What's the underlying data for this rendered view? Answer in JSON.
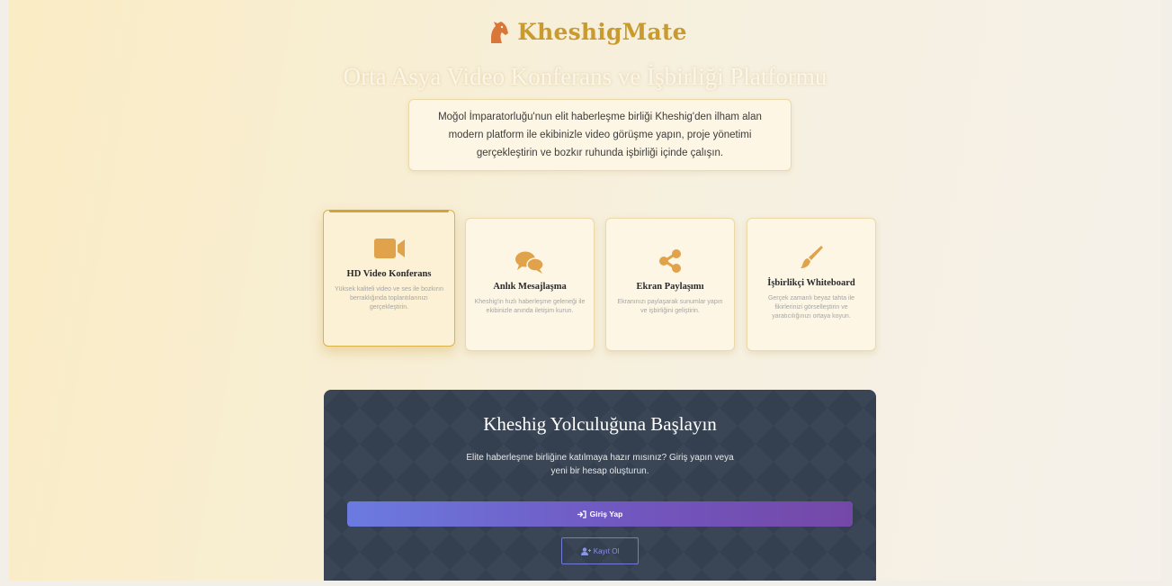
{
  "brand": {
    "name": "KheshigMate",
    "logo": "horse-head-icon"
  },
  "hero": {
    "subtitle": "Orta Asya Video Konferans ve İşbirliği Platformu",
    "intro": "Moğol İmparatorluğu'nun elit haberleşme birliği Kheshig'den ilham alan modern platform ile ekibinizle video görüşme yapın, proje yönetimi gerçekleştirin ve bozkır ruhunda işbirliği içinde çalışın."
  },
  "features": [
    {
      "icon": "video-camera-icon",
      "title": "HD Video Konferans",
      "desc": "Yüksek kaliteli video ve ses ile bozkırın berraklığında toplantılarınızı gerçekleştirin."
    },
    {
      "icon": "chat-bubbles-icon",
      "title": "Anlık Mesajlaşma",
      "desc": "Kheshig'in hızlı haberleşme geleneği ile ekibinizle anında iletişim kurun."
    },
    {
      "icon": "share-icon",
      "title": "Ekran Paylaşımı",
      "desc": "Ekranınızı paylaşarak sunumlar yapın ve işbirliğini geliştirin."
    },
    {
      "icon": "paint-brush-icon",
      "title": "İşbirlikçi Whiteboard",
      "desc": "Gerçek zamanlı beyaz tahta ile fikirlerinizi görselleştirin ve yaratıcılığınızı ortaya koyun."
    }
  ],
  "cta": {
    "title": "Kheshig Yolculuğuna Başlayın",
    "text": "Elite haberleşme birliğine katılmaya hazır mısınız? Giriş yapın veya yeni bir hesap oluşturun.",
    "login_label": "Giriş Yap",
    "register_label": "Kayıt Ol"
  },
  "colors": {
    "accent": "#d4a23c",
    "brand": "#c99a2e",
    "icon": "#e0a24a",
    "cta_bg": "#34404f"
  }
}
